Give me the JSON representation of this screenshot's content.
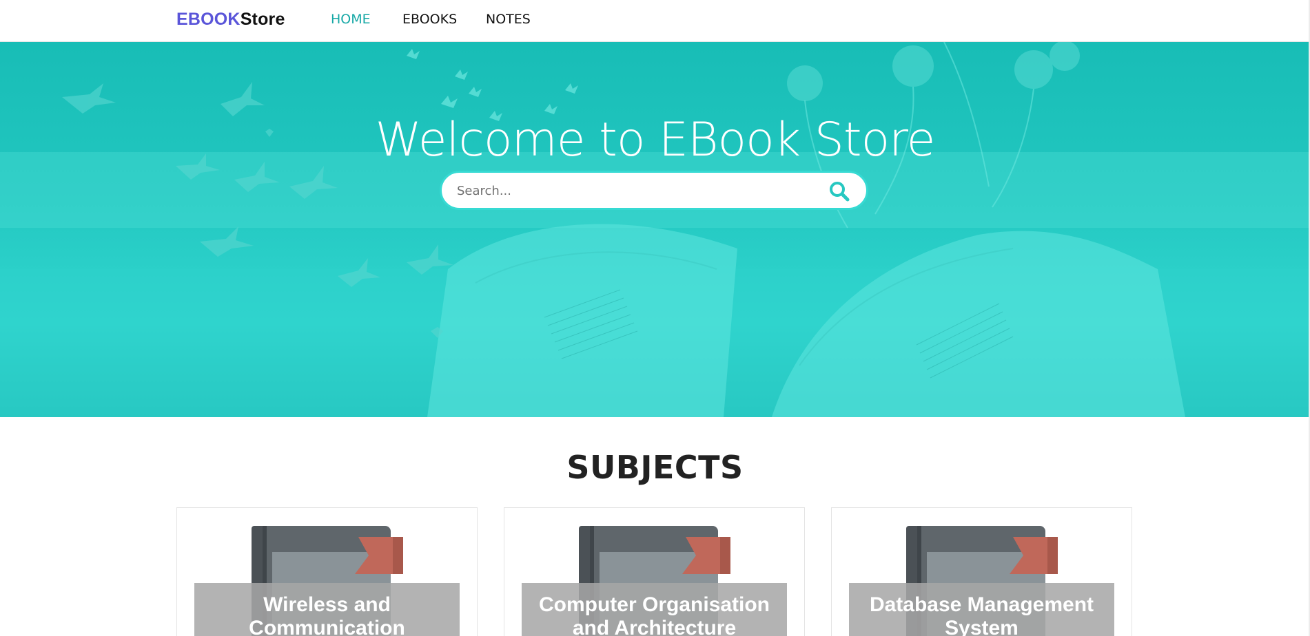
{
  "nav": {
    "brand_part1": "EBOOK",
    "brand_part2": "Store",
    "links": [
      {
        "label": "HOME",
        "active": true
      },
      {
        "label": "EBOOKS",
        "active": false
      },
      {
        "label": "NOTES",
        "active": false
      }
    ]
  },
  "hero": {
    "title": "Welcome to EBook Store",
    "search": {
      "placeholder": "Search...",
      "value": ""
    },
    "search_icon": "search-icon"
  },
  "subjects": {
    "heading": "SUBJECTS",
    "cards": [
      {
        "title": "Wireless and Communication",
        "icon": "book-icon"
      },
      {
        "title": "Computer Organisation and Architecture",
        "icon": "book-icon"
      },
      {
        "title": "Database Management System",
        "icon": "book-icon"
      }
    ]
  },
  "colors": {
    "brand_accent": "#5a55d9",
    "nav_active": "#17a8a6",
    "hero_teal": "#22c7c0",
    "search_border": "#36dad3",
    "book_ribbon": "#c0685a"
  }
}
